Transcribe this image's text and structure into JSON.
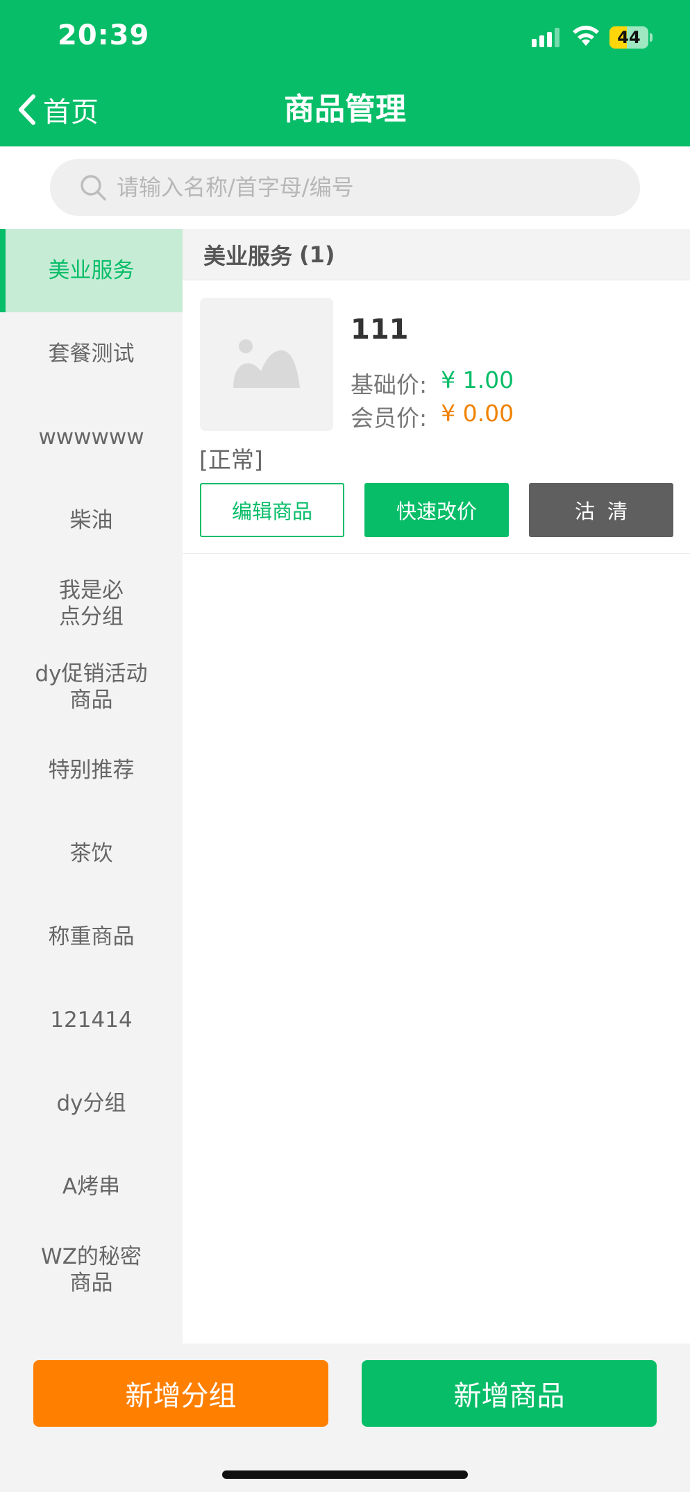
{
  "status_bar": {
    "time": "20:39",
    "battery": "44",
    "battery_level": 0.44
  },
  "nav": {
    "back_label": "首页",
    "title": "商品管理"
  },
  "search": {
    "placeholder": "请输入名称/首字母/编号",
    "value": ""
  },
  "sidebar": {
    "items": [
      {
        "label": "美业服务",
        "active": true
      },
      {
        "label": "套餐测试"
      },
      {
        "label": "wwwwww"
      },
      {
        "label": "柴油"
      },
      {
        "label": "我是必点分组"
      },
      {
        "label": "dy促销活动商品"
      },
      {
        "label": "特别推荐"
      },
      {
        "label": "茶饮"
      },
      {
        "label": "称重商品"
      },
      {
        "label": "121414"
      },
      {
        "label": "dy分组"
      },
      {
        "label": "A烤串"
      },
      {
        "label": "WZ的秘密商品"
      }
    ]
  },
  "group": {
    "name": "美业服务",
    "count": "(1)"
  },
  "product": {
    "name": "111",
    "base_price_label": "基础价:",
    "base_price": "¥ 1.00",
    "member_price_label": "会员价:",
    "member_price": "¥ 0.00",
    "status": "[正常]",
    "edit_label": "编辑商品",
    "quick_price_label": "快速改价",
    "sold_out_label": "沽清"
  },
  "bottom": {
    "add_group_label": "新增分组",
    "add_product_label": "新增商品"
  },
  "colors": {
    "primary": "#07bd68",
    "accent_orange": "#ff7f00",
    "price_orange": "#f08200",
    "dark_button": "#5f5f5f"
  }
}
